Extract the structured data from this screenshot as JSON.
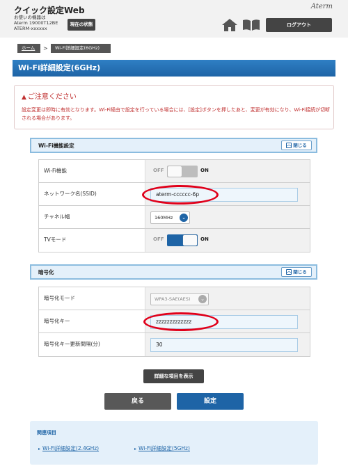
{
  "header": {
    "app_title": "クイック設定Web",
    "device_label": "お使いの機器は",
    "model": "Aterm 19000T12BE",
    "ssid_id": "ATERM-xxxxxx",
    "status_button": "現在の状態",
    "brand": "Aterm",
    "logout_button": "ログアウト"
  },
  "breadcrumb": {
    "home": "ホーム",
    "separator": ">",
    "current": "Wi-Fi詳細設定(6GHz)"
  },
  "page_title": "Wi-Fi詳細設定(6GHz)",
  "notice": {
    "title": "ご注意ください",
    "text": "設定変更は即時に有効となります。Wi-Fi経由で設定を行っている場合には、[設定]ボタンを押したあと、変更が有効になり、Wi-Fi接続が切断される場合があります。"
  },
  "wifi_section": {
    "title": "Wi-Fi機能設定",
    "close_label": "閉じる",
    "wifi_function": {
      "label": "Wi-Fi機能",
      "off": "OFF",
      "on": "ON",
      "state": "off"
    },
    "ssid": {
      "label": "ネットワーク名(SSID)",
      "value": "aterm-cccccc-6p"
    },
    "channel_width": {
      "label": "チャネル幅",
      "value": "160MHz"
    },
    "tv_mode": {
      "label": "TVモード",
      "off": "OFF",
      "on": "ON",
      "state": "on"
    }
  },
  "encryption_section": {
    "title": "暗号化",
    "close_label": "閉じる",
    "mode": {
      "label": "暗号化モード",
      "value": "WPA3-SAE(AES)"
    },
    "key": {
      "label": "暗号化キー",
      "value": "zzzzzzzzzzzzz"
    },
    "renew_interval": {
      "label": "暗号化キー更新間隔(分)",
      "value": "30"
    }
  },
  "buttons": {
    "show_details": "詳細な項目を表示",
    "back": "戻る",
    "set": "設定"
  },
  "related": {
    "title": "関連項目",
    "links": [
      "Wi-Fi詳細設定(2.4GHz)",
      "Wi-Fi詳細設定(5GHz)"
    ]
  },
  "colors": {
    "primary_blue": "#1e64a6",
    "warning_red": "#c03030",
    "annotation_red": "#e0001a"
  }
}
